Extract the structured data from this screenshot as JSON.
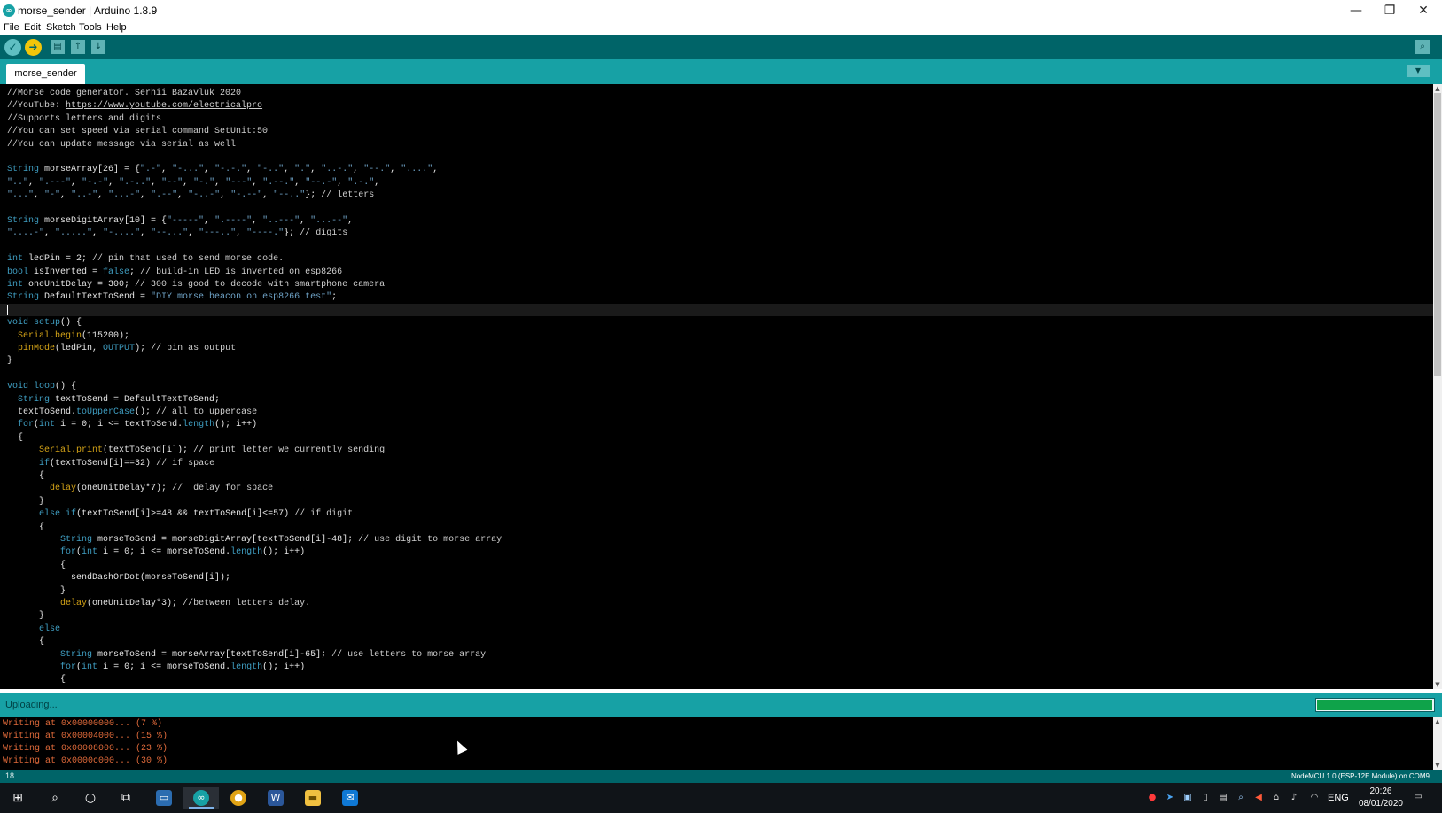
{
  "window": {
    "title": "morse_sender | Arduino 1.8.9",
    "app_icon": "∞",
    "minimize": "—",
    "maximize": "❐",
    "close": "✕"
  },
  "menu": [
    "File",
    "Edit",
    "Sketch",
    "Tools",
    "Help"
  ],
  "toolbar": {
    "verify_icon": "✓",
    "upload_icon": "➜",
    "new_icon": "▤",
    "open_icon": "↑",
    "save_icon": "↓",
    "serial_monitor_icon": "⌕",
    "colors": {
      "bg": "#006468",
      "verify": "#5fbfc2",
      "upload": "#f2c60a"
    }
  },
  "tab": {
    "label": "morse_sender",
    "menu_icon": "▼"
  },
  "editor": {
    "lines": [
      "//Morse code generator. Serhii Bazavluk 2020",
      "//YouTube: https://www.youtube.com/electricalpro",
      "//Supports letters and digits",
      "//You can set speed via serial command SetUnit:50",
      "//You can update message via serial as well",
      "",
      "String morseArray[26] = {\".-\", \"-...\", \"-.-.\", \"-..\", \".\", \"..-.\", \"--.\", \"....\",",
      "\"..\", \".---\", \"-.-\", \".-..\", \"--\", \"-.\", \"---\", \".--.\", \"--.-\", \".-.\",",
      "\"...\", \"-\", \"..-\", \"...-\", \".--\", \"-..-\", \"-.--\", \"--..\"}; // letters",
      "",
      "String morseDigitArray[10] = {\"-----\", \".----\", \"..---\", \"...--\",",
      "\"....-\", \".....\", \"-....\", \"--...\", \"---..\", \"----.\"}; // digits",
      "",
      "int ledPin = 2; // pin that used to send morse code.",
      "bool isInverted = false; // build-in LED is inverted on esp8266",
      "int oneUnitDelay = 300; // 300 is good to decode with smartphone camera",
      "String DefaultTextToSend = \"DIY morse beacon on esp8266 test\";",
      "",
      "void setup() {",
      "  Serial.begin(115200);",
      "  pinMode(ledPin, OUTPUT); // pin as output",
      "}",
      "",
      "void loop() {",
      "  String textToSend = DefaultTextToSend;",
      "  textToSend.toUpperCase(); // all to uppercase",
      "  for(int i = 0; i <= textToSend.length(); i++)",
      "  {",
      "      Serial.print(textToSend[i]); // print letter we currently sending",
      "      if(textToSend[i]==32) // if space",
      "      {",
      "        delay(oneUnitDelay*7); //  delay for space",
      "      }",
      "      else if(textToSend[i]>=48 && textToSend[i]<=57) // if digit",
      "      {",
      "          String morseToSend = morseDigitArray[textToSend[i]-48]; // use digit to morse array",
      "          for(int i = 0; i <= morseToSend.length(); i++)",
      "          {",
      "            sendDashOrDot(morseToSend[i]);",
      "          }",
      "          delay(oneUnitDelay*3); //between letters delay.",
      "      }",
      "      else",
      "      {",
      "          String morseToSend = morseArray[textToSend[i]-65]; // use letters to morse array",
      "          for(int i = 0; i <= morseToSend.length(); i++)",
      "          {"
    ]
  },
  "status": {
    "text": "Uploading...",
    "progress_fraction": 0.99
  },
  "console": {
    "lines": [
      "Writing at 0x00000000... (7 %)",
      "Writing at 0x00004000... (15 %)",
      "Writing at 0x00008000... (23 %)",
      "Writing at 0x0000c000... (30 %)"
    ]
  },
  "footer": {
    "line_number": "18",
    "board": "NodeMCU 1.0 (ESP-12E Module) on COM9"
  },
  "taskbar": {
    "start_icon": "windows-start-icon",
    "apps": [
      "search-icon",
      "cortana-icon",
      "task-view-icon",
      "remote-desktop-icon",
      "arduino-icon",
      "chrome-icon",
      "word-icon",
      "file-explorer-icon",
      "outlook-icon"
    ],
    "language": "ENG",
    "time": "20:26",
    "date": "08/01/2020"
  }
}
